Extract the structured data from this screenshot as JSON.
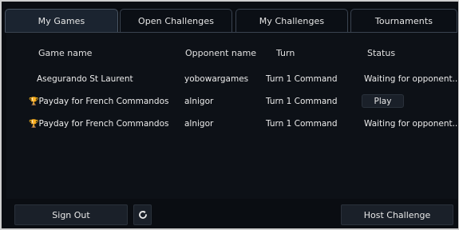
{
  "tabs": [
    {
      "label": "My Games",
      "active": true
    },
    {
      "label": "Open Challenges",
      "active": false
    },
    {
      "label": "My Challenges",
      "active": false
    },
    {
      "label": "Tournaments",
      "active": false
    }
  ],
  "columns": {
    "game_name": "Game name",
    "opponent_name": "Opponent name",
    "turn": "Turn",
    "status": "Status"
  },
  "games": [
    {
      "name": "Asegurando St Laurent",
      "trophy": false,
      "opponent": "yobowargames",
      "turn": "Turn 1 Command",
      "status": "Waiting for opponent..."
    },
    {
      "name": "Payday for French Commandos",
      "trophy": true,
      "opponent": "alnigor",
      "turn": "Turn 1 Command",
      "status_button": "Play"
    },
    {
      "name": "Payday for French Commandos",
      "trophy": true,
      "opponent": "alnigor",
      "turn": "Turn 1 Command",
      "status": "Waiting for opponent..."
    }
  ],
  "footer": {
    "sign_out": "Sign Out",
    "refresh_icon": "refresh-icon",
    "host_challenge": "Host Challenge"
  },
  "colors": {
    "background": "#0a0d12",
    "panel": "#0d1117",
    "active_tab": "#1b2430",
    "trophy": "#d9a521",
    "text": "#ececec"
  }
}
